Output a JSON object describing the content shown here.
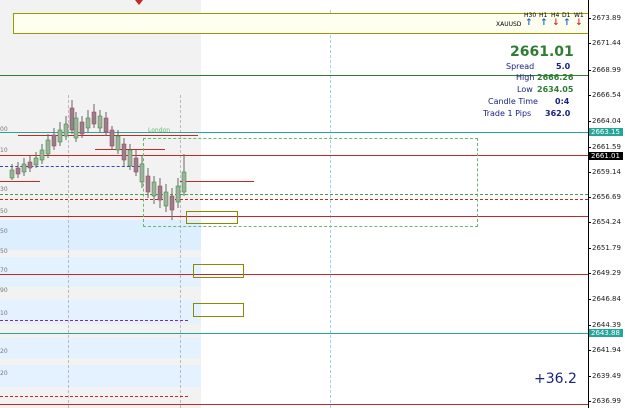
{
  "symbol": "XAUUSD",
  "timeframes": [
    {
      "label": "H30",
      "arrow": "↑",
      "color": "#1565c0"
    },
    {
      "label": "H1",
      "arrow": "↑",
      "color": "#1565c0"
    },
    {
      "label": "H4",
      "arrow": "↓",
      "color": "#d32f2f"
    },
    {
      "label": "D1",
      "arrow": "↑",
      "color": "#1565c0"
    },
    {
      "label": "W1",
      "arrow": "↓",
      "color": "#d32f2f"
    }
  ],
  "info_panel": {
    "price": "2661.01",
    "spread_label": "Spread",
    "spread_value": "5.0",
    "high_label": "High",
    "high_value": "2666.26",
    "low_label": "Low",
    "low_value": "2634.05",
    "candle_time_label": "Candle Time",
    "candle_time_value": "0:4",
    "trade_pips_label": "Trade 1 Pips",
    "trade_pips_value": "362.0"
  },
  "session_label": "London",
  "profit_label": "+36.2",
  "price_axis": {
    "ticks": [
      "2673.89",
      "2671.44",
      "2668.99",
      "2666.54",
      "2664.04",
      "2661.59",
      "2659.14",
      "2656.69",
      "2654.24",
      "2651.79",
      "2649.29",
      "2646.84",
      "2644.39",
      "2641.94",
      "2639.49",
      "2636.99"
    ],
    "tag_line_1": "2663.15",
    "tag_current": "2661.01",
    "tag_line_2": "2643.88"
  },
  "left_labels": [
    "00",
    "10",
    "30",
    "50",
    "50",
    "50",
    "70",
    "90",
    "10",
    "20",
    "20"
  ],
  "colors": {
    "green_line": "#2e7d32",
    "teal_line": "#26a69a",
    "red_line": "#c62828",
    "bull_candle": "#00a000",
    "bear_candle": "#d81b60",
    "zone_blue": "#ddeeff",
    "box_olive": "#8a8a00",
    "info_green": "#2e7d32",
    "info_text": "#1a237e"
  }
}
